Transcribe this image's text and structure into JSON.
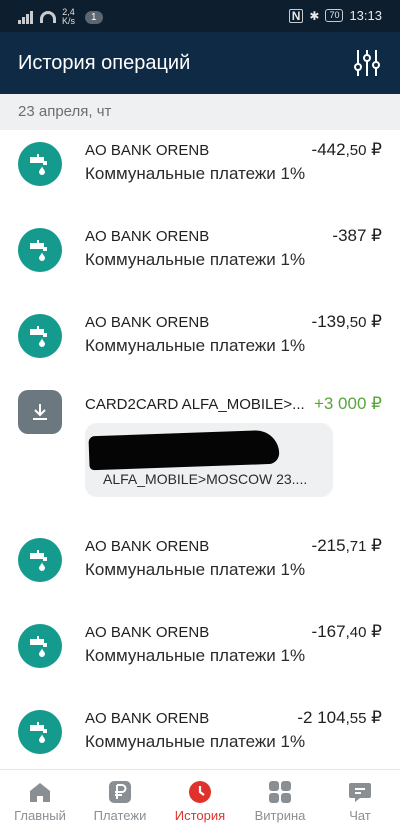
{
  "status_bar": {
    "speed_value": "2,4",
    "speed_unit": "K/s",
    "notification_count": "1",
    "nfc_label": "N",
    "battery_level": "70",
    "time": "13:13"
  },
  "header": {
    "title": "История операций",
    "filter_icon": "sliders-icon"
  },
  "date_group": "23 апреля, чт",
  "transactions": [
    {
      "name": "AO BANK ORENB",
      "category": "Коммунальные платежи 1%",
      "amount_main": "-442",
      "amount_cents": ",50",
      "currency": "₽",
      "icon": "water-tap-icon"
    },
    {
      "name": "AO BANK ORENB",
      "category": "Коммунальные платежи 1%",
      "amount_main": "-387",
      "amount_cents": "",
      "currency": "₽",
      "icon": "water-tap-icon"
    },
    {
      "name": "AO BANK ORENB",
      "category": "Коммунальные платежи 1%",
      "amount_main": "-139",
      "amount_cents": ",50",
      "currency": "₽",
      "icon": "water-tap-icon"
    },
    {
      "name": "CARD2CARD ALFA_MOBILE>...",
      "message": "ALFA_MOBILE>MOSCOW 23....",
      "amount_main": "+3 000",
      "amount_cents": "",
      "currency": "₽",
      "icon": "download-icon"
    },
    {
      "name": "AO BANK ORENB",
      "category": "Коммунальные платежи 1%",
      "amount_main": "-215",
      "amount_cents": ",71",
      "currency": "₽",
      "icon": "water-tap-icon"
    },
    {
      "name": "AO BANK ORENB",
      "category": "Коммунальные платежи 1%",
      "amount_main": "-167",
      "amount_cents": ",40",
      "currency": "₽",
      "icon": "water-tap-icon"
    },
    {
      "name": "AO BANK ORENB",
      "category": "Коммунальные платежи 1%",
      "amount_main": "-2 104",
      "amount_cents": ",55",
      "currency": "₽",
      "icon": "water-tap-icon"
    }
  ],
  "colors": {
    "header_bg": "#0f2a44",
    "utility_icon": "#159a8e",
    "income_amount": "#5aa53a",
    "active_tab": "#e0322d"
  },
  "bottom_nav": [
    {
      "label": "Главный",
      "icon": "home-icon"
    },
    {
      "label": "Платежи",
      "icon": "ruble-icon"
    },
    {
      "label": "История",
      "icon": "clock-icon",
      "active": true
    },
    {
      "label": "Витрина",
      "icon": "grid-icon"
    },
    {
      "label": "Чат",
      "icon": "chat-icon"
    }
  ]
}
